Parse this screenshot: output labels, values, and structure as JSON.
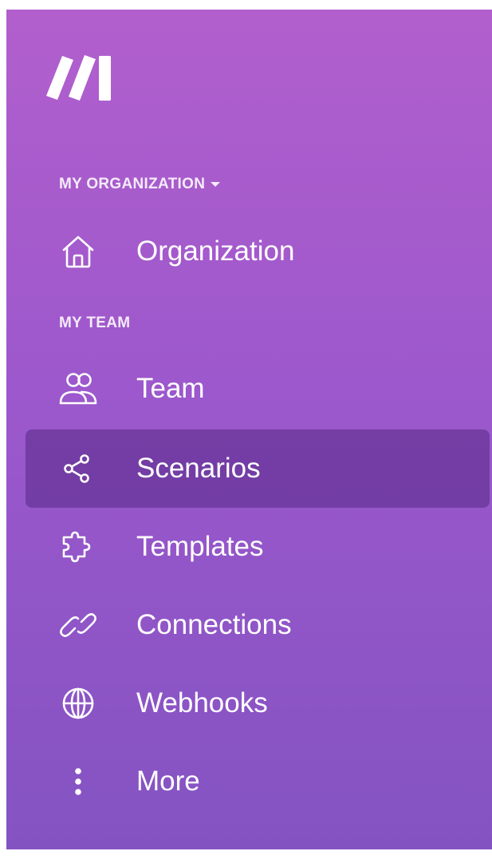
{
  "sidebar": {
    "logo_icon": "make-logo-icon",
    "org_section": {
      "label": "MY ORGANIZATION",
      "caret_icon": "caret-down-icon"
    },
    "team_section": {
      "label": "MY TEAM"
    },
    "items": [
      {
        "label": "Organization",
        "icon": "home-icon",
        "active": false
      },
      {
        "label": "Team",
        "icon": "users-icon",
        "active": false
      },
      {
        "label": "Scenarios",
        "icon": "share-nodes-icon",
        "active": true
      },
      {
        "label": "Templates",
        "icon": "puzzle-icon",
        "active": false
      },
      {
        "label": "Connections",
        "icon": "link-icon",
        "active": false
      },
      {
        "label": "Webhooks",
        "icon": "globe-icon",
        "active": false
      },
      {
        "label": "More",
        "icon": "more-vertical-icon",
        "active": false
      }
    ]
  },
  "colors": {
    "gradient_top": "#b25fcd",
    "gradient_bottom": "#8453c2",
    "active_item_bg": "#7a3f9e",
    "text": "#ffffff"
  }
}
